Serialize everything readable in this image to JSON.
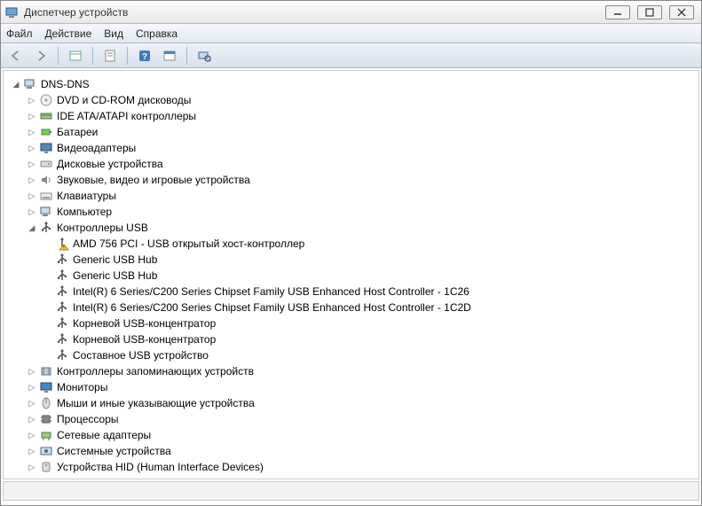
{
  "window": {
    "title": "Диспетчер устройств"
  },
  "menu": {
    "file": "Файл",
    "action": "Действие",
    "view": "Вид",
    "help": "Справка"
  },
  "tree": {
    "root": "DNS-DNS",
    "categories": [
      {
        "label": "DVD и CD-ROM дисководы",
        "icon": "disc"
      },
      {
        "label": "IDE ATA/ATAPI контроллеры",
        "icon": "ide"
      },
      {
        "label": "Батареи",
        "icon": "battery"
      },
      {
        "label": "Видеоадаптеры",
        "icon": "display"
      },
      {
        "label": "Дисковые устройства",
        "icon": "drive"
      },
      {
        "label": "Звуковые, видео и игровые устройства",
        "icon": "sound"
      },
      {
        "label": "Клавиатуры",
        "icon": "keyboard"
      },
      {
        "label": "Компьютер",
        "icon": "computer"
      },
      {
        "label": "Контроллеры USB",
        "icon": "usb",
        "expanded": true,
        "children": [
          {
            "label": "AMD 756 PCI - USB открытый хост-контроллер",
            "icon": "usb-warn"
          },
          {
            "label": "Generic USB Hub",
            "icon": "usb"
          },
          {
            "label": "Generic USB Hub",
            "icon": "usb"
          },
          {
            "label": "Intel(R) 6 Series/C200 Series Chipset Family USB Enhanced Host Controller - 1C26",
            "icon": "usb"
          },
          {
            "label": "Intel(R) 6 Series/C200 Series Chipset Family USB Enhanced Host Controller - 1C2D",
            "icon": "usb"
          },
          {
            "label": "Корневой USB-концентратор",
            "icon": "usb"
          },
          {
            "label": "Корневой USB-концентратор",
            "icon": "usb"
          },
          {
            "label": "Составное USB устройство",
            "icon": "usb"
          }
        ]
      },
      {
        "label": "Контроллеры запоминающих устройств",
        "icon": "storage"
      },
      {
        "label": "Мониторы",
        "icon": "monitor"
      },
      {
        "label": "Мыши и иные указывающие устройства",
        "icon": "mouse"
      },
      {
        "label": "Процессоры",
        "icon": "cpu"
      },
      {
        "label": "Сетевые адаптеры",
        "icon": "network"
      },
      {
        "label": "Системные устройства",
        "icon": "system"
      },
      {
        "label": "Устройства HID (Human Interface Devices)",
        "icon": "hid"
      }
    ]
  }
}
